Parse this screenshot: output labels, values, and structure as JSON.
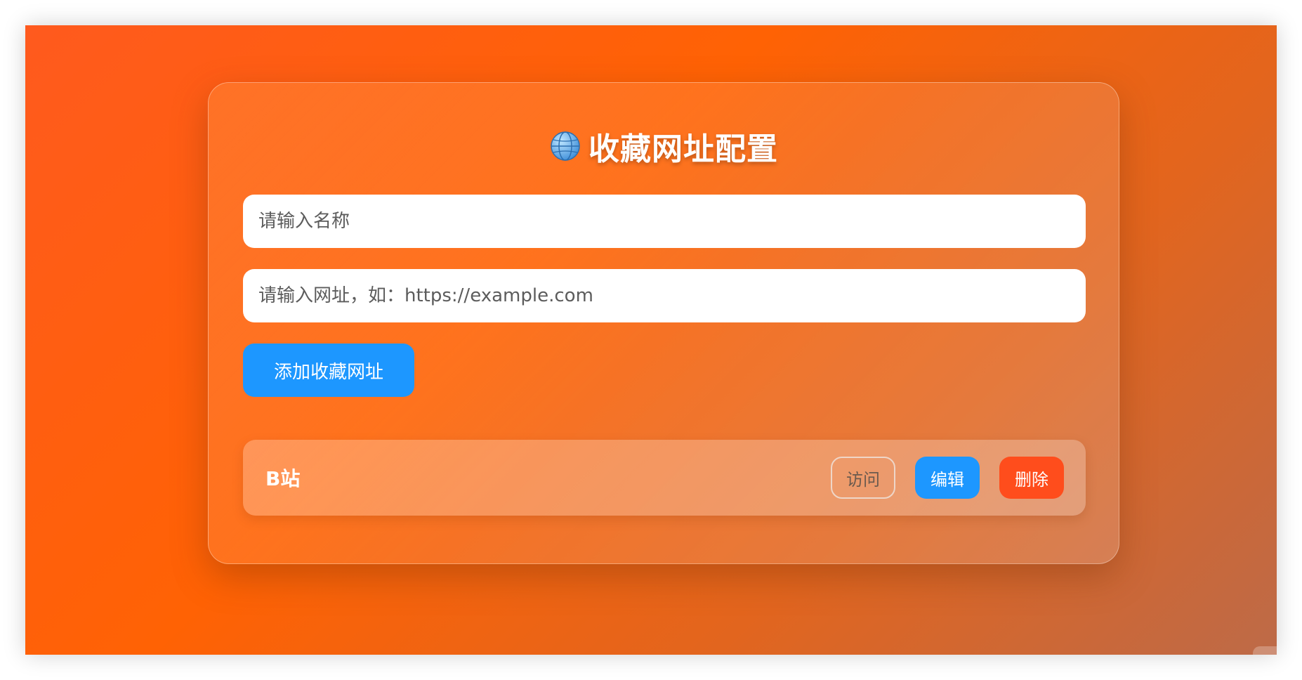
{
  "page": {
    "title": "收藏网址配置",
    "title_icon": "globe-icon"
  },
  "form": {
    "name_placeholder": "请输入名称",
    "url_placeholder": "请输入网址，如：https://example.com",
    "add_label": "添加收藏网址"
  },
  "bookmarks": [
    {
      "name": "B站",
      "visit_label": "访问",
      "edit_label": "编辑",
      "delete_label": "删除"
    }
  ],
  "colors": {
    "background_start": "#ff5a1e",
    "background_end": "#bd6a48",
    "primary": "#1d97ff",
    "danger": "#ff4d1c"
  }
}
